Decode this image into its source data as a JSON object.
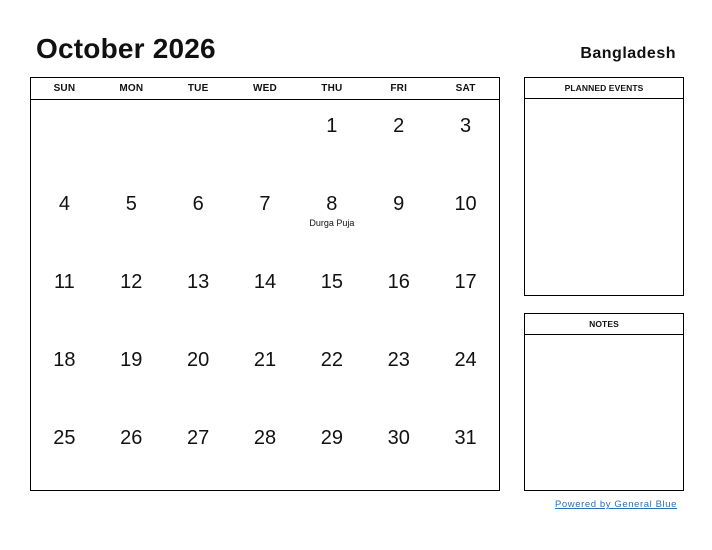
{
  "header": {
    "title": "October 2026",
    "country": "Bangladesh"
  },
  "calendar": {
    "weekdays": [
      "SUN",
      "MON",
      "TUE",
      "WED",
      "THU",
      "FRI",
      "SAT"
    ],
    "weeks": [
      [
        {
          "day": ""
        },
        {
          "day": ""
        },
        {
          "day": ""
        },
        {
          "day": ""
        },
        {
          "day": "1"
        },
        {
          "day": "2"
        },
        {
          "day": "3"
        }
      ],
      [
        {
          "day": "4"
        },
        {
          "day": "5"
        },
        {
          "day": "6"
        },
        {
          "day": "7"
        },
        {
          "day": "8",
          "event": "Durga Puja"
        },
        {
          "day": "9"
        },
        {
          "day": "10"
        }
      ],
      [
        {
          "day": "11"
        },
        {
          "day": "12"
        },
        {
          "day": "13"
        },
        {
          "day": "14"
        },
        {
          "day": "15"
        },
        {
          "day": "16"
        },
        {
          "day": "17"
        }
      ],
      [
        {
          "day": "18"
        },
        {
          "day": "19"
        },
        {
          "day": "20"
        },
        {
          "day": "21"
        },
        {
          "day": "22"
        },
        {
          "day": "23"
        },
        {
          "day": "24"
        }
      ],
      [
        {
          "day": "25"
        },
        {
          "day": "26"
        },
        {
          "day": "27"
        },
        {
          "day": "28"
        },
        {
          "day": "29"
        },
        {
          "day": "30"
        },
        {
          "day": "31"
        }
      ]
    ]
  },
  "panels": {
    "planned_events": "PLANNED EVENTS",
    "notes": "NOTES"
  },
  "footer": {
    "link_text": "Powered by General Blue",
    "link_color": "#2a6fba"
  }
}
